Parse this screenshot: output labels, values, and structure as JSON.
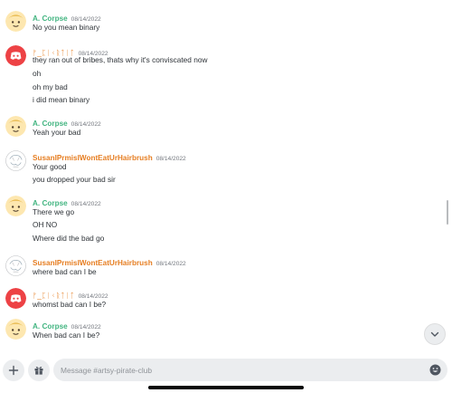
{
  "channel": {
    "placeholder": "Message #artsy-pirate-club"
  },
  "icons": {
    "avatar_corpse": "cartoon-face-avatar",
    "avatar_rune": "discord-logo-avatar",
    "avatar_susan": "sketch-avatar",
    "jump": "chevron-down-icon",
    "plus": "plus-icon",
    "gift": "gift-icon",
    "emoji": "emoji-icon"
  },
  "colors": {
    "corpse_name": "#43b581",
    "susan_name": "#e67e22",
    "rune_name": "#e67e22",
    "discord_avatar": "#ed4245"
  },
  "messages": [
    {
      "author": "A. Corpse",
      "time": "08/14/2022",
      "lines": [
        "No you mean binary"
      ]
    },
    {
      "author": "ᚠ_ᛈᛁᚲᚱᛏᛁᛏ",
      "time": "08/14/2022",
      "lines": [
        "they ran out of bribes, thats why it's conviscated now",
        "oh",
        "oh my bad",
        "i did mean binary"
      ]
    },
    {
      "author": "A. Corpse",
      "time": "08/14/2022",
      "lines": [
        "Yeah your bad"
      ]
    },
    {
      "author": "SusanIPrmisIWontEatUrHairbrush",
      "time": "08/14/2022",
      "lines": [
        "Your good",
        "you dropped your bad sir"
      ]
    },
    {
      "author": "A. Corpse",
      "time": "08/14/2022",
      "lines": [
        "There we go",
        "OH NO",
        "Where did the bad go"
      ]
    },
    {
      "author": "SusanIPrmisIWontEatUrHairbrush",
      "time": "08/14/2022",
      "lines": [
        "where bad can I be"
      ]
    },
    {
      "author": "ᚠ_ᛈᛁᚲᚱᛏᛁᛏ",
      "time": "08/14/2022",
      "lines": [
        "whomst bad can I be?"
      ]
    },
    {
      "author": "A. Corpse",
      "time": "08/14/2022",
      "lines": [
        "When bad can I be?"
      ]
    }
  ]
}
